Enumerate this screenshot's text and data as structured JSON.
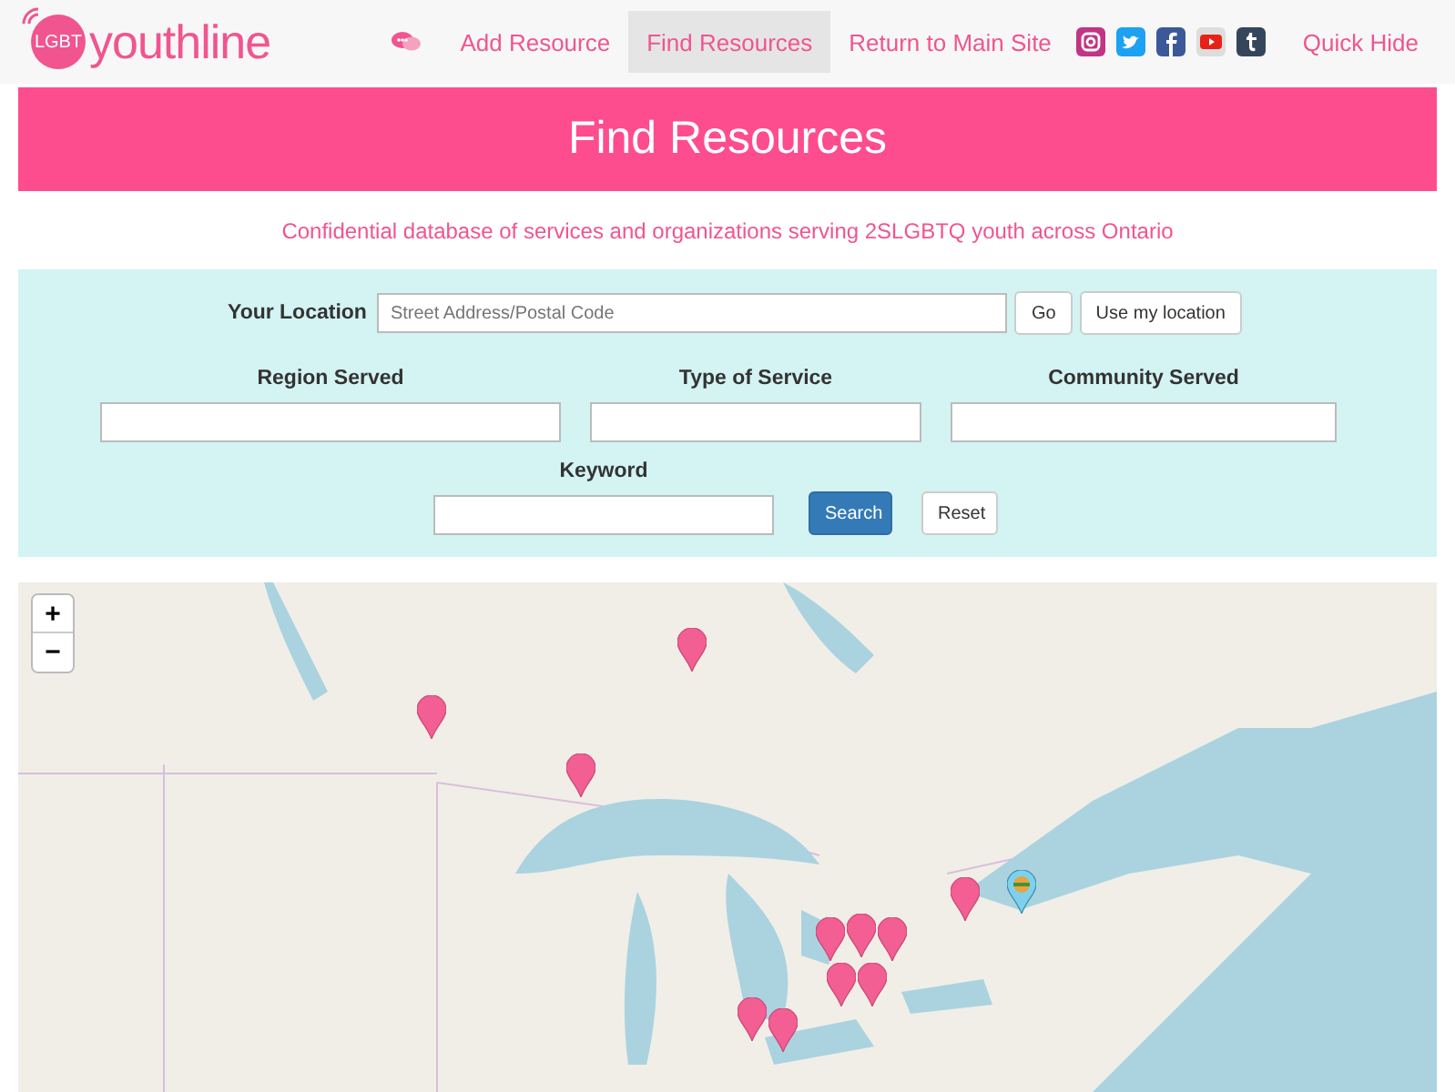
{
  "header": {
    "logo": {
      "badge": "LGBT",
      "wordmark": "youthline"
    },
    "nav": [
      {
        "label": "Add Resource",
        "selected": false
      },
      {
        "label": "Find Resources",
        "selected": true
      },
      {
        "label": "Return to Main Site",
        "selected": false
      }
    ],
    "quick_hide": "Quick Hide"
  },
  "banner": {
    "title": "Find Resources"
  },
  "subtitle": "Confidential database of services and organizations serving 2SLGBTQ youth across Ontario",
  "search_form": {
    "location": {
      "label": "Your Location",
      "placeholder": "Street Address/Postal Code",
      "go": "Go",
      "use_location": "Use my location"
    },
    "filters": [
      {
        "label": "Region Served"
      },
      {
        "label": "Type of Service"
      },
      {
        "label": "Community Served"
      }
    ],
    "keyword": {
      "label": "Keyword"
    },
    "search": "Search",
    "reset": "Reset"
  },
  "map": {
    "zoom_in": "+",
    "zoom_out": "−"
  }
}
